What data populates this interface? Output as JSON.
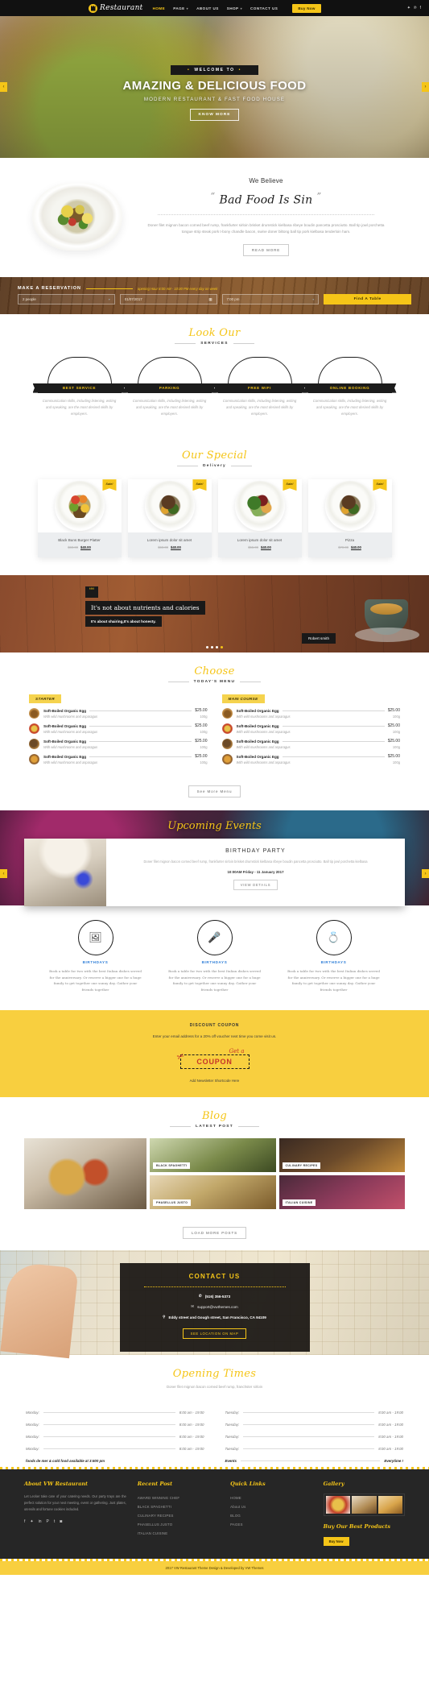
{
  "header": {
    "brand": "Restaurant",
    "nav": [
      {
        "label": "Home",
        "active": true,
        "caret": false
      },
      {
        "label": "Page",
        "active": false,
        "caret": true
      },
      {
        "label": "About Us",
        "active": false,
        "caret": false
      },
      {
        "label": "Shop",
        "active": false,
        "caret": true
      },
      {
        "label": "CONTACT US",
        "active": false,
        "caret": false
      }
    ],
    "buy_now": "Buy Now",
    "socials": [
      "twitter-icon",
      "pinterest-icon",
      "facebook-icon"
    ]
  },
  "hero": {
    "ribbon": "WELCOME TO",
    "title": "AMAZING & DELICIOUS FOOD",
    "subtitle": "MODERN RESTAURANT & FAST FOOD HOUSE",
    "button": "KNOW MORE",
    "prev": "‹",
    "next": "›"
  },
  "believe": {
    "heading": "We Believe",
    "quote": "Bad Food Is Sin",
    "quote_open": "“",
    "quote_close": "”",
    "paragraph": "Doner filet mignon bacon corned beef rump, frankfurter sirloin brisket drumstick kielbasa ribeye boudin pancetta prosciutto. Ball tip jowl porchetta tongue strip steak pork t-bony chandle bacon, swine doner biltong ball tip pork kielbasa tenderloin ham.",
    "button": "READ MORE"
  },
  "reservation": {
    "heading": "MAKE A RESERVATION",
    "note": "opening Hour 8:00 AM - 10:00 PM every day on week",
    "people": "2 people",
    "date": "01/07/2017",
    "time": "7:00 pm",
    "button": "Find A Table",
    "caret": "▾",
    "calendar_icon": "calendar-icon"
  },
  "services": {
    "title": "Look Our",
    "subtitle": "SERVICES",
    "items": [
      {
        "label": "BEST SERVICE",
        "text": "Communication skills, including listening, writing and speaking, are the most desired skills by employers."
      },
      {
        "label": "PARKING",
        "text": "Communication skills, including listening, writing and speaking, are the most desired skills by employers."
      },
      {
        "label": "FREE WIFI",
        "text": "Communication skills, including listening, writing and speaking, are the most desired skills by employers."
      },
      {
        "label": "ONLINE BOOKING",
        "text": "Communication skills, including listening, writing and speaking, are the most desired skills by employers."
      }
    ]
  },
  "special": {
    "title": "Our Special",
    "subtitle": "Delivery",
    "sale_badge": "Sale!",
    "items": [
      {
        "name": "Black Buns Burger Platter",
        "old_price": "$60.00",
        "price": "$40.00"
      },
      {
        "name": "Lorem ipsum dolor sit amet",
        "old_price": "$60.00",
        "price": "$40.00"
      },
      {
        "name": "Lorem ipsum dolor sit amet",
        "old_price": "$55.00",
        "price": "$40.00"
      },
      {
        "name": "Pizza",
        "old_price": "$70.00",
        "price": "$40.00"
      }
    ]
  },
  "testimonial": {
    "mark": "““",
    "quote": "It's not about nutrients and calories",
    "subquote": "It's about shairing,It's about honesty.",
    "author": "Robert smith",
    "dots": 4,
    "active_dot": 4
  },
  "todays_menu": {
    "title": "Choose",
    "subtitle": "TODAY'S MENU",
    "columns": [
      {
        "badge": "STARTER",
        "items": [
          {
            "name": "Soft-Boiled Organic Egg",
            "price": "$25.00",
            "desc": "With wild mushrooms and asparagus",
            "gram": "100g"
          },
          {
            "name": "Soft-Boiled Organic Egg",
            "price": "$25.00",
            "desc": "With wild mushrooms and asparagus",
            "gram": "100g"
          },
          {
            "name": "Soft-Boiled Organic Egg",
            "price": "$25.00",
            "desc": "With wild mushrooms and asparagus",
            "gram": "100g"
          },
          {
            "name": "Soft-Boiled Organic Egg",
            "price": "$25.00",
            "desc": "With wild mushrooms and asparagus",
            "gram": "100g"
          }
        ]
      },
      {
        "badge": "MAIN COURSE",
        "items": [
          {
            "name": "Soft-Boiled Organic Egg",
            "price": "$25.00",
            "desc": "With wild mushrooms and asparagus",
            "gram": "100g"
          },
          {
            "name": "Soft-Boiled Organic Egg",
            "price": "$25.00",
            "desc": "With wild mushrooms and asparagus",
            "gram": "100g"
          },
          {
            "name": "Soft-Boiled Organic Egg",
            "price": "$25.00",
            "desc": "With wild mushrooms and asparagus",
            "gram": "100g"
          },
          {
            "name": "Soft-Boiled Organic Egg",
            "price": "$25.00",
            "desc": "With wild mushrooms and asparagus",
            "gram": "100g"
          }
        ]
      }
    ],
    "button": "See More Menu"
  },
  "events": {
    "title": "Upcoming Events",
    "card": {
      "heading": "BIRTHDAY PARTY",
      "text": "Doner filet mignon bacon corned beef rump, frankfurter sirloin brisket drumstick kielbasa ribeye boudin pancetta prosciutto. Ball tip jowl porchetta kielbasa",
      "date": "10:00AM Friday - 11 January 2017",
      "button": "VIEW DETAILS"
    },
    "prev": "‹",
    "next": "›"
  },
  "features": [
    {
      "icon": "photo-frame-icon",
      "glyph": "🖼",
      "label": "BIRTHDAYS",
      "text": "Book a table for two with the best Italian dishes served for the anniversary. Or reserve a bigger one for a huge family to get together one sunny day. Gather your friends together"
    },
    {
      "icon": "speaker-podium-icon",
      "glyph": "🎤",
      "label": "BIRTHDAYS",
      "text": "Book a table for two with the best Italian dishes served for the anniversary. Or reserve a bigger one for a huge family to get together one sunny day. Gather your friends together"
    },
    {
      "icon": "wedding-rings-icon",
      "glyph": "💍",
      "label": "BIRTHDAYS",
      "text": "Book a table for two with the best Italian dishes served for the anniversary. Or reserve a bigger one for a huge family to get together one sunny day. Gather your friends together"
    }
  ],
  "coupon": {
    "heading": "DISCOUNT COUPON",
    "paragraph": "Enter your email address for a 20% off voucher next time you come visit us.",
    "get_a": "Get a",
    "word": "COUPON",
    "scissors_icon": "scissors-icon",
    "note": "Add Newsletter Shortcode Here"
  },
  "blog": {
    "title": "Blog",
    "subtitle": "LATEST POST",
    "posts": [
      {
        "caption": ""
      },
      {
        "caption": "BLACK SPAGHETTI"
      },
      {
        "caption": "CULINARY RECIPES"
      },
      {
        "caption": "PHASELLUS JUSTO"
      },
      {
        "caption": "ITALIAN CUISINE"
      }
    ],
    "button": "LOAD MORE POSTS"
  },
  "contact": {
    "heading": "CONTACT US",
    "phone": "(516) 356-5373",
    "phone_icon": "phone-icon",
    "email": "support@vwthemes.com",
    "email_icon": "mail-icon",
    "address": "Eddy street and Gough street, San Francisco, CA 94109",
    "address_icon": "pin-icon",
    "button": "SEE LOCATION ON MAP"
  },
  "opening": {
    "title": "Opening Times",
    "paragraph": "Doner filet mignon bacon corned beef rump, franchster sirloin",
    "left": [
      {
        "day": "Monday:",
        "time": "8:00 am - 19:00"
      },
      {
        "day": "Monday:",
        "time": "8:00 am - 19:00"
      },
      {
        "day": "Monday:",
        "time": "8:00 am - 19:00"
      },
      {
        "day": "Monday:",
        "time": "8:00 am - 19:00"
      }
    ],
    "right": [
      {
        "day": "Tuesday:",
        "time": "8:00 am - 19:00"
      },
      {
        "day": "Tuesday:",
        "time": "8:00 am - 19:00"
      },
      {
        "day": "Tuesday:",
        "time": "8:00 am - 19:00"
      },
      {
        "day": "Tuesday:",
        "time": "8:00 am - 19:00"
      }
    ],
    "footer_left": "foods de mer & cold food available at 3:600 pm",
    "footer_right_day": "Events",
    "footer_right_time": "Everytime !"
  },
  "footer": {
    "about_title": "About VW Restaurant",
    "about_text": "Let Lecker take care of your catering needs. Our party trays are the perfect solution for your next meeting, event or gathering. Just plates, utensils and fortune cookies included.",
    "socials": [
      "facebook-icon",
      "twitter-icon",
      "linkedin-icon",
      "pinterest-icon",
      "tumblr-icon",
      "instagram-icon"
    ],
    "recent_title": "Recent Post",
    "recent": [
      "AWARD WINNING CHEF",
      "BLACK SPAGHETTI",
      "CULINARY RECIPES",
      "PHASELLUS JUSTO",
      "ITALIAN CUISINE"
    ],
    "quick_title": "Quick Links",
    "quick": [
      "HOME",
      "About Us",
      "BLOG",
      "PAGES"
    ],
    "gallery_title": "Gallery",
    "buy_title": "Buy Our Best Products",
    "buy_button": "Buy Now",
    "copyright": "2017 VW Restaurant Theme Design & Developed by VW Themes"
  }
}
